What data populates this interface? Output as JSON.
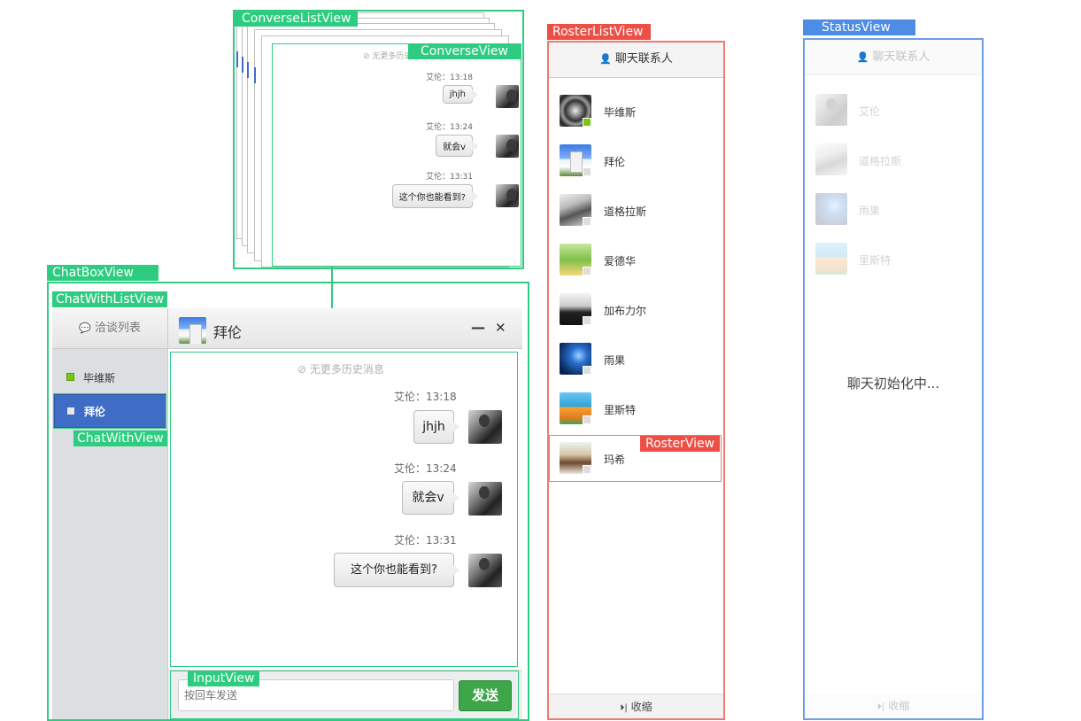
{
  "labels": {
    "converse_list_view": "ConverseListView",
    "converse_view": "ConverseView",
    "chatbox_view": "ChatBoxView",
    "chat_with_list_view": "ChatWithListView",
    "chat_with_view": "ChatWithView",
    "input_view": "InputView",
    "roster_list_view": "RosterListView",
    "roster_view": "RosterView",
    "status_view": "StatusView"
  },
  "chat_messages": {
    "no_more_history": "无更多历史消息",
    "messages": [
      {
        "time": "艾伦：13:18",
        "text": "jhjh"
      },
      {
        "time": "艾伦：13:24",
        "text": "就会v"
      },
      {
        "time": "艾伦：13:31",
        "text": "这个你也能看到?"
      }
    ]
  },
  "chatbox": {
    "list_title": "洽谈列表",
    "contacts": [
      {
        "name": "毕维斯",
        "online": true,
        "selected": false
      },
      {
        "name": "拜伦",
        "online": false,
        "selected": true
      }
    ],
    "active_contact": "拜伦",
    "minimize_symbol": "—",
    "close_symbol": "✕",
    "input_placeholder": "按回车发送",
    "send_label": "发送"
  },
  "roster": {
    "title": "聊天联系人",
    "contacts": [
      {
        "name": "毕维斯",
        "online": true,
        "avatar": "spiral"
      },
      {
        "name": "拜伦",
        "online": false,
        "avatar": "building"
      },
      {
        "name": "道格拉斯",
        "online": false,
        "avatar": "bw"
      },
      {
        "name": "爱德华",
        "online": false,
        "avatar": "green"
      },
      {
        "name": "加布力尔",
        "online": false,
        "avatar": "sil"
      },
      {
        "name": "雨果",
        "online": false,
        "avatar": "blue"
      },
      {
        "name": "里斯特",
        "online": false,
        "avatar": "cartoon"
      },
      {
        "name": "玛希",
        "online": false,
        "avatar": "woman"
      }
    ],
    "collapse_label": "收缩"
  },
  "status": {
    "title": "聊天联系人",
    "contacts": [
      "艾伦",
      "道格拉斯",
      "雨果",
      "里斯特"
    ],
    "loading_text": "聊天初始化中...",
    "collapse_label": "收缩"
  },
  "colors": {
    "converse_green": "#2ecc80",
    "roster_red": "#ee4f45",
    "status_blue": "#4d8de6",
    "online_green": "#7ac70c",
    "selected_blue": "#3f6cc4",
    "send_green": "#3ea548"
  },
  "icons": [
    "user-icon",
    "comments-icon",
    "ban-icon",
    "collapse-icon",
    "minimize-icon",
    "close-icon"
  ]
}
